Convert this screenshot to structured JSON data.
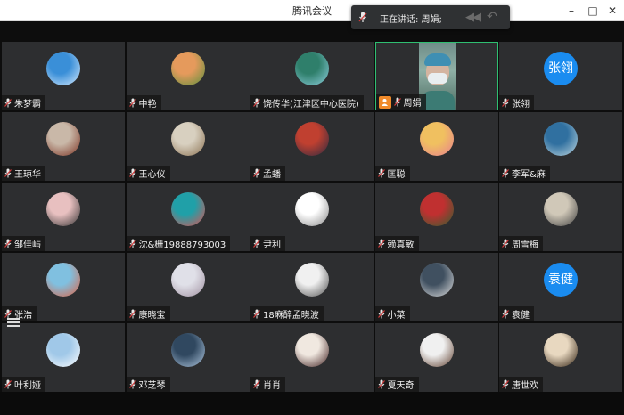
{
  "window": {
    "title": "腾讯会议",
    "minimize_icon": "minimize-icon",
    "maximize_icon": "maximize-icon",
    "close_icon": "close-icon"
  },
  "speaking": {
    "label": "正在讲话: 周娟;"
  },
  "colors": {
    "tile_bg": "#2d2e30",
    "active_border": "#2fbf71",
    "text_avatar": "#1a8cf0",
    "camera_tag": "#f08a2a"
  },
  "participants": [
    {
      "name": "朱梦霸",
      "avatar": "photo"
    },
    {
      "name": "中艳",
      "avatar": "photo"
    },
    {
      "name": "饶传华(江津区中心医院)",
      "avatar": "photo"
    },
    {
      "name": "周娟",
      "avatar": "video"
    },
    {
      "name": "张翎",
      "avatar": "text",
      "initials": "张翎"
    },
    {
      "name": "王琼华",
      "avatar": "photo"
    },
    {
      "name": "王心仪",
      "avatar": "photo"
    },
    {
      "name": "孟蟠",
      "avatar": "photo"
    },
    {
      "name": "匡聪",
      "avatar": "photo"
    },
    {
      "name": "李军&麻",
      "avatar": "photo"
    },
    {
      "name": "邹佳屿",
      "avatar": "photo"
    },
    {
      "name": "沈&栅19888793003",
      "avatar": "photo"
    },
    {
      "name": "尹利",
      "avatar": "photo"
    },
    {
      "name": "赖真敏",
      "avatar": "photo"
    },
    {
      "name": "周雪梅",
      "avatar": "photo"
    },
    {
      "name": "张浩",
      "avatar": "photo"
    },
    {
      "name": "康晓宝",
      "avatar": "photo"
    },
    {
      "name": "18麻醉孟晓波",
      "avatar": "photo"
    },
    {
      "name": "小菜",
      "avatar": "photo"
    },
    {
      "name": "袁健",
      "avatar": "text",
      "initials": "袁健"
    },
    {
      "name": "叶利娅",
      "avatar": "photo"
    },
    {
      "name": "邓芝琴",
      "avatar": "photo"
    },
    {
      "name": "肖肖",
      "avatar": "photo"
    },
    {
      "name": "夏天奇",
      "avatar": "photo"
    },
    {
      "name": "唐世欢",
      "avatar": "photo"
    }
  ]
}
